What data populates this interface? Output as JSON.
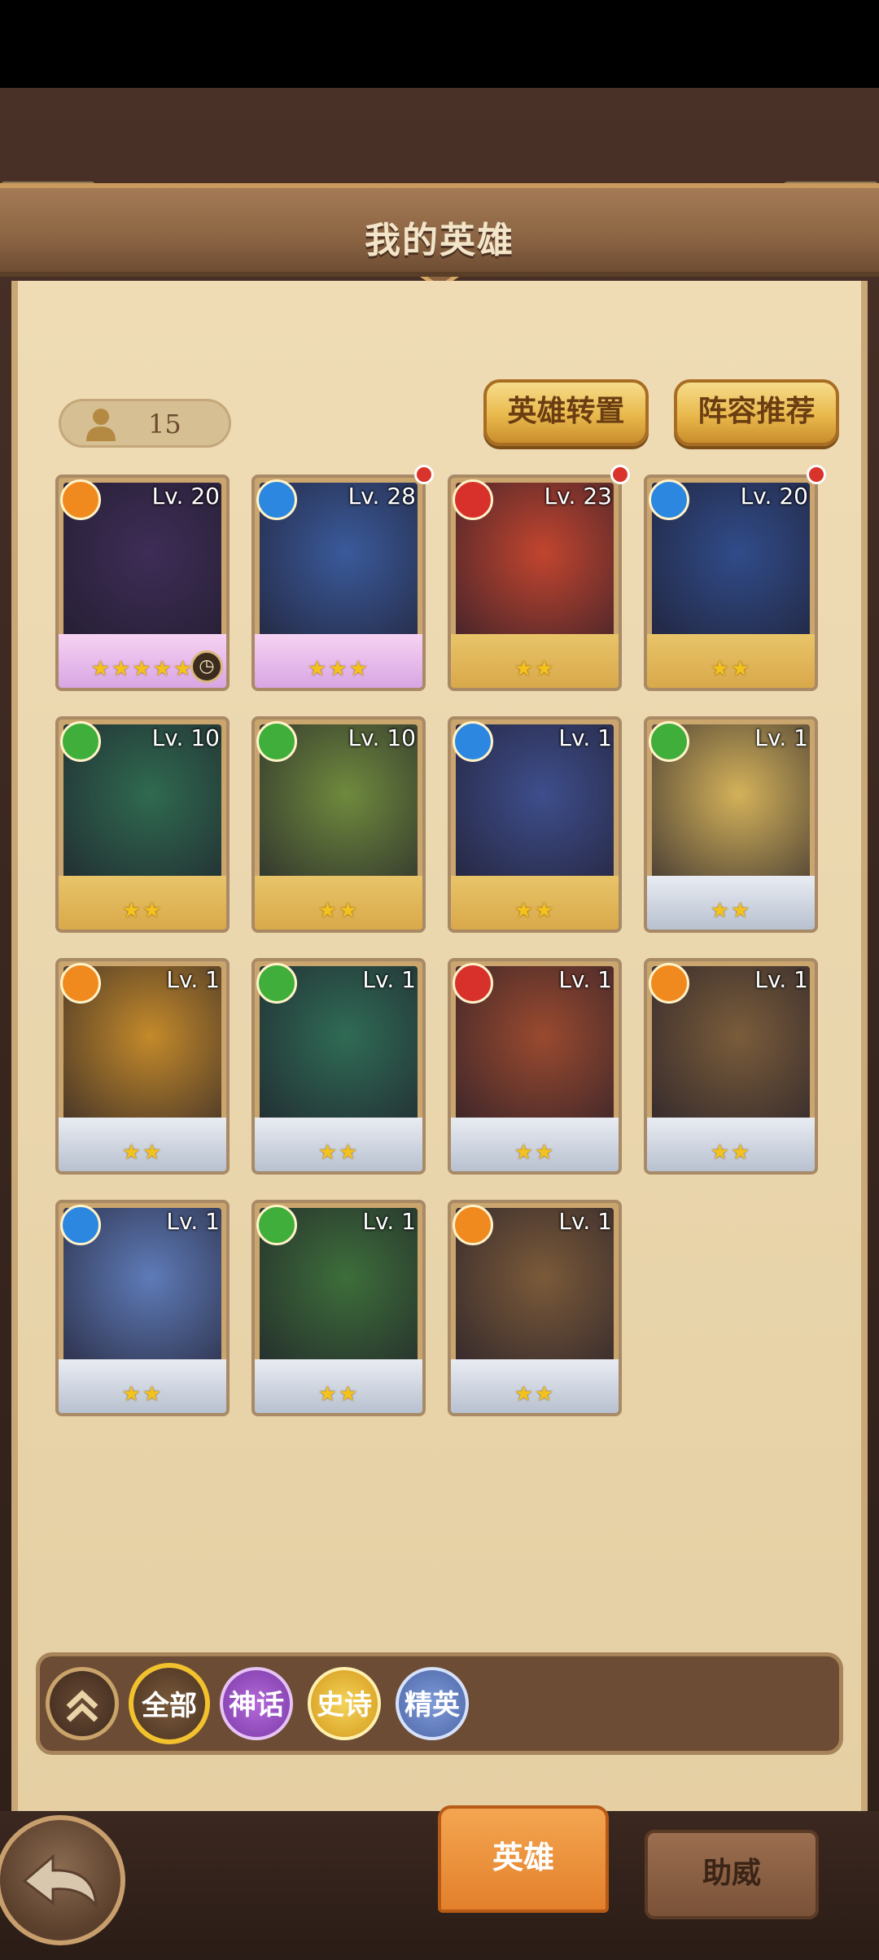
{
  "title": "我的英雄",
  "hero_count": "15",
  "buttons": {
    "transfer": "英雄转置",
    "lineup": "阵容推荐"
  },
  "heroes": [
    {
      "level": "Lv. 20",
      "element": "fire",
      "rarity": "legend",
      "stars": "★★★★★",
      "timer": true
    },
    {
      "level": "Lv. 28",
      "element": "water",
      "rarity": "legend",
      "stars": "★★★",
      "new": true
    },
    {
      "level": "Lv. 23",
      "element": "blood",
      "rarity": "gold",
      "stars": "★★",
      "new": true
    },
    {
      "level": "Lv. 20",
      "element": "water",
      "rarity": "gold",
      "stars": "★★",
      "new": true
    },
    {
      "level": "Lv. 10",
      "element": "nature",
      "rarity": "gold",
      "stars": "★★"
    },
    {
      "level": "Lv. 10",
      "element": "nature",
      "rarity": "gold",
      "stars": "★★"
    },
    {
      "level": "Lv. 1",
      "element": "water",
      "rarity": "gold",
      "stars": "★★"
    },
    {
      "level": "Lv. 1",
      "element": "nature",
      "rarity": "silver",
      "stars": "★★"
    },
    {
      "level": "Lv. 1",
      "element": "fire",
      "rarity": "silver",
      "stars": "★★"
    },
    {
      "level": "Lv. 1",
      "element": "nature",
      "rarity": "silver",
      "stars": "★★"
    },
    {
      "level": "Lv. 1",
      "element": "blood",
      "rarity": "silver",
      "stars": "★★"
    },
    {
      "level": "Lv. 1",
      "element": "fire",
      "rarity": "silver",
      "stars": "★★"
    },
    {
      "level": "Lv. 1",
      "element": "water",
      "rarity": "silver",
      "stars": "★★"
    },
    {
      "level": "Lv. 1",
      "element": "nature",
      "rarity": "silver",
      "stars": "★★"
    },
    {
      "level": "Lv. 1",
      "element": "fire",
      "rarity": "silver",
      "stars": "★★"
    }
  ],
  "filters": {
    "all": "全部",
    "mythic": "神话",
    "epic": "史诗",
    "elite": "精英"
  },
  "tabs": {
    "hero": "英雄",
    "assist": "助威"
  },
  "colors": {
    "fire": "#f08a1e",
    "water": "#2b87e0",
    "blood": "#d8312b",
    "nature": "#3fae3a",
    "portrait_bg": [
      "#3e2d57",
      "#3a5a9b",
      "#c2452f",
      "#304c8a",
      "#2f6a50",
      "#6f8a3d",
      "#3e4e8c",
      "#d4b25a",
      "#c48a2a",
      "#2f6b55",
      "#9a4a2f",
      "#7a5c3a",
      "#5e7bb8",
      "#3d6e3a",
      "#7b5a39"
    ]
  }
}
